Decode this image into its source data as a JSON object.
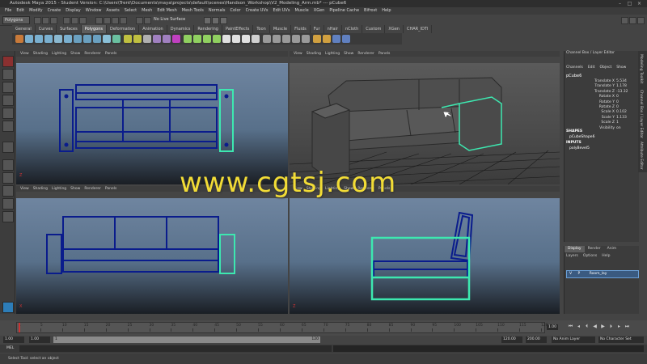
{
  "window": {
    "title": "Autodesk Maya 2015 - Student Version: C:\\Users\\Trent\\Documents\\maya\\projects\\default\\scenes\\Handson_Workshop\\V2_Modeling_Arm.mb* --- pCube6"
  },
  "menubar": [
    "File",
    "Edit",
    "Modify",
    "Create",
    "Display",
    "Window",
    "Assets",
    "Select",
    "Mesh",
    "Edit Mesh",
    "Mesh Tools",
    "Normals",
    "Color",
    "Create UVs",
    "Edit UVs",
    "Muscle",
    "XGen",
    "Pipeline Cache",
    "Bifrost",
    "Help"
  ],
  "status_line": {
    "mode": "Polygons",
    "live_surface": "No Live Surface"
  },
  "shelf_tabs": [
    "General",
    "Curves",
    "Surfaces",
    "Polygons",
    "Deformation",
    "Animation",
    "Dynamics",
    "Rendering",
    "PaintEffects",
    "Toon",
    "Muscle",
    "Fluids",
    "Fur",
    "nHair",
    "nCloth",
    "Custom",
    "XGen",
    "CHAR_IDTI"
  ],
  "shelf_active": "Polygons",
  "panel_menu": [
    "View",
    "Shading",
    "Lighting",
    "Show",
    "Renderer",
    "Panels"
  ],
  "watermark": "www.cgtsj.com",
  "channel_box": {
    "header": "Channel Box / Layer Editor",
    "menu": [
      "Channels",
      "Edit",
      "Object",
      "Show"
    ],
    "object": "pCube6",
    "attributes": [
      {
        "name": "Translate X",
        "value": "5.534"
      },
      {
        "name": "Translate Y",
        "value": "1.178"
      },
      {
        "name": "Translate Z",
        "value": "-13.32"
      },
      {
        "name": "Rotate X",
        "value": "0"
      },
      {
        "name": "Rotate Y",
        "value": "0"
      },
      {
        "name": "Rotate Z",
        "value": "0"
      },
      {
        "name": "Scale X",
        "value": "0.102"
      },
      {
        "name": "Scale Y",
        "value": "1.133"
      },
      {
        "name": "Scale Z",
        "value": "1"
      },
      {
        "name": "Visibility",
        "value": "on"
      }
    ],
    "shapes_label": "SHAPES",
    "shape": "pCubeShape6",
    "inputs_label": "INPUTS",
    "input": "polyBevel5"
  },
  "side_tabs": [
    "Modeling Toolkit",
    "Channel Box / Layer Editor",
    "Attribute Editor"
  ],
  "layer_editor": {
    "tabs": [
      "Display",
      "Render",
      "Anim"
    ],
    "active_tab": "Display",
    "menu": [
      "Layers",
      "Options",
      "Help"
    ],
    "layer": {
      "v": "V",
      "p": "P",
      "name": "Room_lay"
    }
  },
  "time_slider": {
    "ticks": [
      "1",
      "5",
      "10",
      "15",
      "20",
      "25",
      "30",
      "35",
      "40",
      "45",
      "50",
      "55",
      "60",
      "65",
      "70",
      "75",
      "80",
      "85",
      "90",
      "95",
      "100",
      "105",
      "110",
      "115",
      "120"
    ],
    "current": "1.00"
  },
  "range_slider": {
    "start": "1.00",
    "inner_start": "1.00",
    "frame": "1",
    "inner_end": "120",
    "end_anim": "120.00",
    "end": "200.00",
    "anim_layer": "No Anim Layer",
    "char_set": "No Character Set"
  },
  "command_line": {
    "label": "MEL"
  },
  "help_line": {
    "text": "Select Tool: select an object"
  },
  "colors": {
    "wire_blue": "#0a1c8c",
    "wire_selected": "#3de8b0",
    "accent": "#4f86c6",
    "watermark": "#f2dc36"
  }
}
